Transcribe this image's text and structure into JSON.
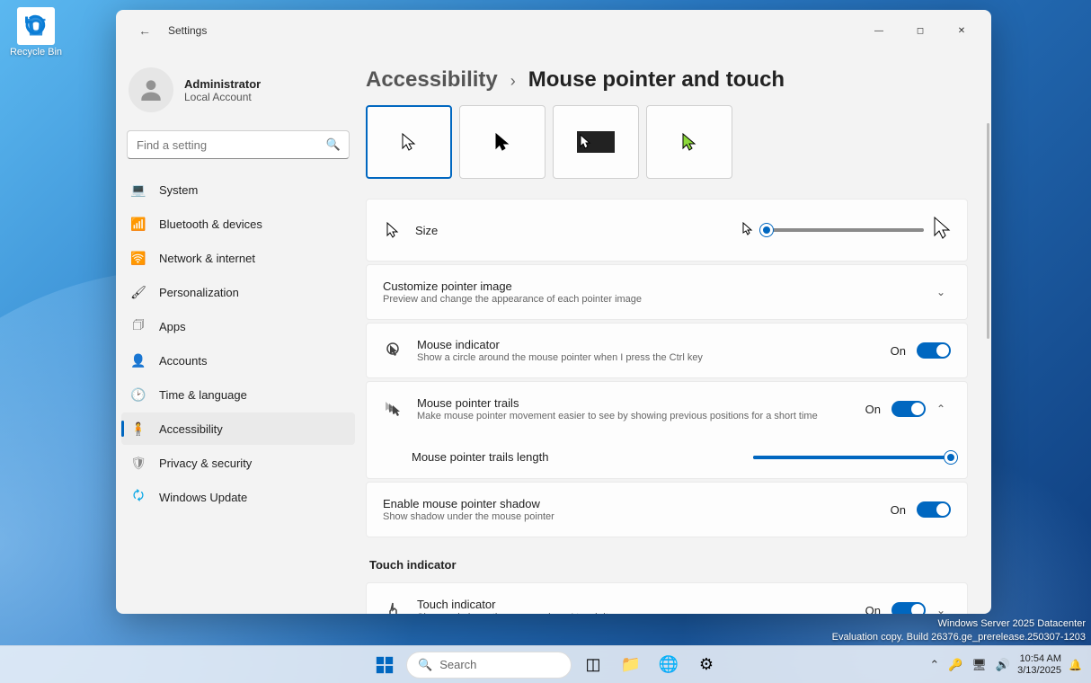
{
  "desktop": {
    "recycle_bin": "Recycle Bin"
  },
  "window": {
    "title": "Settings",
    "profile": {
      "name": "Administrator",
      "type": "Local Account"
    },
    "search_placeholder": "Find a setting",
    "nav": [
      {
        "label": "System"
      },
      {
        "label": "Bluetooth & devices"
      },
      {
        "label": "Network & internet"
      },
      {
        "label": "Personalization"
      },
      {
        "label": "Apps"
      },
      {
        "label": "Accounts"
      },
      {
        "label": "Time & language"
      },
      {
        "label": "Accessibility"
      },
      {
        "label": "Privacy & security"
      },
      {
        "label": "Windows Update"
      }
    ],
    "breadcrumb": {
      "parent": "Accessibility",
      "current": "Mouse pointer and touch"
    },
    "size_label": "Size",
    "customize": {
      "title": "Customize pointer image",
      "desc": "Preview and change the appearance of each pointer image"
    },
    "indicator": {
      "title": "Mouse indicator",
      "desc": "Show a circle around the mouse pointer when I press the Ctrl key",
      "state": "On"
    },
    "trails": {
      "title": "Mouse pointer trails",
      "desc": "Make mouse pointer movement easier to see by showing previous positions for a short time",
      "state": "On",
      "length_label": "Mouse pointer trails length"
    },
    "shadow": {
      "title": "Enable mouse pointer shadow",
      "desc": "Show shadow under the mouse pointer",
      "state": "On"
    },
    "touch_section": "Touch indicator",
    "touch": {
      "title": "Touch indicator",
      "desc": "Show a circle on the screen where I touch it",
      "state": "On"
    }
  },
  "taskbar": {
    "search_placeholder": "Search",
    "time": "10:54 AM",
    "date": "3/13/2025"
  },
  "watermark": {
    "line1": "Windows Server 2025 Datacenter",
    "line2": "Evaluation copy. Build 26376.ge_prerelease.250307-1203"
  }
}
